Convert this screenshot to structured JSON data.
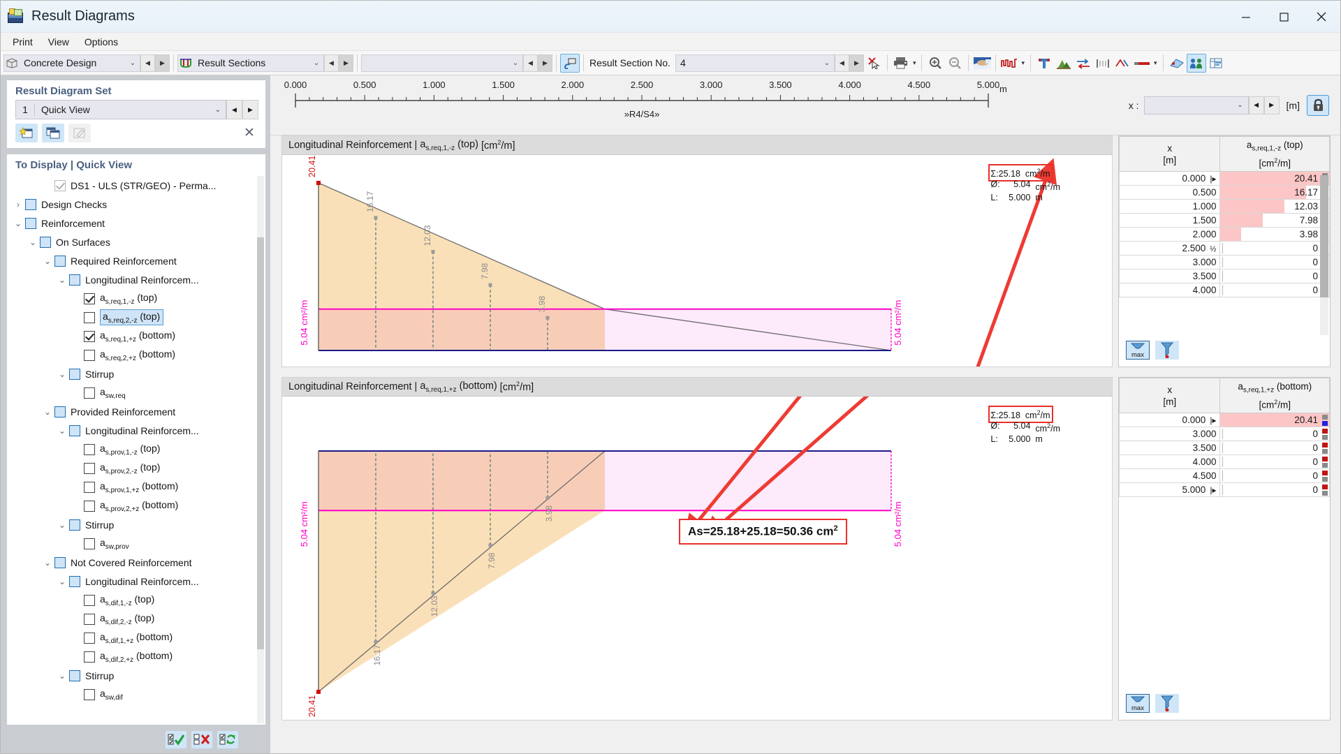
{
  "window": {
    "title": "Result Diagrams",
    "icon": "result-diagrams-icon",
    "minimize": "–",
    "maximize": "□",
    "close": "✕"
  },
  "menu": {
    "items": [
      "Print",
      "View",
      "Options"
    ]
  },
  "toolbar": {
    "module_combo": {
      "value": "Concrete Design",
      "icon": "cube-icon"
    },
    "type_combo": {
      "value": "Result Sections",
      "icon": "result-section-icon"
    },
    "blank_combo": {
      "value": ""
    },
    "snap_button": {
      "name": "pointer-snap-icon"
    },
    "section_label": "Result Section No.",
    "section_value": "4",
    "delete_button": "delete-cursor-icon",
    "print_button": "print-icon",
    "zoom_in_button": "zoom-in-icon",
    "zoom_out_button": "zoom-out-icon",
    "render_button": "render-icon",
    "diagram_button": "diagram-icon",
    "icons": [
      "tee-icon",
      "landscape-icon",
      "exchange-icon",
      "grid-icon",
      "ruler-icon",
      "line-style-icon",
      "surface-icon",
      "people-icon",
      "table-icon"
    ]
  },
  "sidebar": {
    "set_card": {
      "title": "Result Diagram Set",
      "number": "1",
      "value": "Quick View",
      "buttons": [
        "new-set-icon",
        "copy-set-icon",
        "edit-set-icon"
      ],
      "close_label": "✕"
    },
    "tree_card": {
      "title": "To Display | Quick View",
      "items": [
        {
          "label": "DS1 - ULS (STR/GEO) - Perma...",
          "indent": 2,
          "twist": "",
          "check": "gray-checked"
        },
        {
          "label": "Design Checks",
          "indent": 0,
          "twist": "›",
          "check": "tint"
        },
        {
          "label": "Reinforcement",
          "indent": 0,
          "twist": "⌄",
          "check": "tint"
        },
        {
          "label": "On Surfaces",
          "indent": 1,
          "twist": "⌄",
          "check": "tint"
        },
        {
          "label": "Required Reinforcement",
          "indent": 2,
          "twist": "⌄",
          "check": "tint"
        },
        {
          "label": "Longitudinal Reinforcem...",
          "indent": 3,
          "twist": "⌄",
          "check": "tint"
        },
        {
          "label": "as,req,1,-z (top)",
          "indent": 4,
          "twist": "",
          "check": "checked"
        },
        {
          "label": "as,req,2,-z (top)",
          "indent": 4,
          "twist": "",
          "check": "dark",
          "selected": true
        },
        {
          "label": "as,req,1,+z (bottom)",
          "indent": 4,
          "twist": "",
          "check": "checked"
        },
        {
          "label": "as,req,2,+z (bottom)",
          "indent": 4,
          "twist": "",
          "check": "dark"
        },
        {
          "label": "Stirrup",
          "indent": 3,
          "twist": "⌄",
          "check": "tint"
        },
        {
          "label": "asw,req",
          "indent": 4,
          "twist": "",
          "check": "dark"
        },
        {
          "label": "Provided Reinforcement",
          "indent": 2,
          "twist": "⌄",
          "check": "tint"
        },
        {
          "label": "Longitudinal Reinforcem...",
          "indent": 3,
          "twist": "⌄",
          "check": "tint"
        },
        {
          "label": "as,prov,1,-z (top)",
          "indent": 4,
          "twist": "",
          "check": "dark"
        },
        {
          "label": "as,prov,2,-z (top)",
          "indent": 4,
          "twist": "",
          "check": "dark"
        },
        {
          "label": "as,prov,1,+z (bottom)",
          "indent": 4,
          "twist": "",
          "check": "dark"
        },
        {
          "label": "as,prov,2,+z (bottom)",
          "indent": 4,
          "twist": "",
          "check": "dark"
        },
        {
          "label": "Stirrup",
          "indent": 3,
          "twist": "⌄",
          "check": "tint"
        },
        {
          "label": "asw,prov",
          "indent": 4,
          "twist": "",
          "check": "dark"
        },
        {
          "label": "Not Covered Reinforcement",
          "indent": 2,
          "twist": "⌄",
          "check": "tint"
        },
        {
          "label": "Longitudinal Reinforcem...",
          "indent": 3,
          "twist": "⌄",
          "check": "tint"
        },
        {
          "label": "as,dif,1,-z (top)",
          "indent": 4,
          "twist": "",
          "check": "dark"
        },
        {
          "label": "as,dif,2,-z (top)",
          "indent": 4,
          "twist": "",
          "check": "dark"
        },
        {
          "label": "as,dif,1,+z (bottom)",
          "indent": 4,
          "twist": "",
          "check": "dark"
        },
        {
          "label": "as,dif,2,+z (bottom)",
          "indent": 4,
          "twist": "",
          "check": "dark"
        },
        {
          "label": "Stirrup",
          "indent": 3,
          "twist": "⌄",
          "check": "tint"
        },
        {
          "label": "asw,dif",
          "indent": 4,
          "twist": "",
          "check": "dark"
        }
      ]
    },
    "footer_buttons": [
      "check-all-icon",
      "uncheck-all-icon",
      "invert-selection-icon"
    ]
  },
  "ruler": {
    "ticks": [
      "0.000",
      "0.500",
      "1.000",
      "1.500",
      "2.000",
      "2.500",
      "3.000",
      "3.500",
      "4.000",
      "4.500",
      "5.000"
    ],
    "unit": "m",
    "section_label": "»R4/S4»"
  },
  "x_control": {
    "label": "x :",
    "value": "",
    "unit": "[m]",
    "lock_icon": "lock-icon"
  },
  "chart_data": [
    {
      "type": "area",
      "title": "Longitudinal Reinforcement | as,req,1,-z (top) [cm2/m]",
      "title_main": "Longitudinal Reinforcement",
      "title_var": "as,req,1,-z (top)",
      "title_unit": "[cm2/m]",
      "xlabel": "",
      "ylabel": "cm2/m",
      "x": [
        0.0,
        0.5,
        1.0,
        1.5,
        2.0,
        2.5,
        3.0,
        3.5,
        4.0
      ],
      "values": [
        20.41,
        16.17,
        12.03,
        7.98,
        3.98,
        0,
        0,
        0,
        0
      ],
      "labels": [
        "20.41",
        "16.17",
        "12.03",
        "7.98",
        "3.98"
      ],
      "threshold_value": 5.04,
      "threshold_label": "5.04 cm2/m",
      "threshold_color": "#ff00c8",
      "fill_above": "#fae0b8",
      "fill_below": "#f8cdb8",
      "xlim": [
        0,
        5
      ],
      "ylim": [
        0,
        20.41
      ],
      "summary": {
        "sum_key": "Σ:",
        "sum_value": "25.18",
        "sum_unit": "cm2/m",
        "avg_key": "Ø:",
        "avg_value": "5.04",
        "avg_unit": "cm2/m",
        "len_key": "L:",
        "len_value": "5.000",
        "len_unit": "m"
      }
    },
    {
      "type": "area",
      "title": "Longitudinal Reinforcement | as,req,1,+z (bottom) [cm2/m]",
      "title_main": "Longitudinal Reinforcement",
      "title_var": "as,req,1,+z (bottom)",
      "title_unit": "[cm2/m]",
      "xlabel": "",
      "ylabel": "cm2/m",
      "x": [
        0.0,
        0.5,
        1.0,
        1.5,
        2.0,
        3.0,
        3.5,
        4.0,
        4.5,
        5.0
      ],
      "values": [
        20.41,
        16.17,
        12.03,
        7.98,
        3.98,
        0,
        0,
        0,
        0,
        0
      ],
      "labels": [
        "20.41",
        "16.17",
        "12.03",
        "7.98",
        "3.98"
      ],
      "threshold_value": 5.04,
      "threshold_label": "5.04 cm2/m",
      "threshold_color": "#ff00c8",
      "fill_above": "#fae0b8",
      "fill_below": "#f8cdb8",
      "xlim": [
        0,
        5
      ],
      "ylim": [
        0,
        20.41
      ],
      "summary": {
        "sum_key": "Σ:",
        "sum_value": "25.18",
        "sum_unit": "cm2/m",
        "avg_key": "Ø:",
        "avg_value": "5.04",
        "avg_unit": "cm2/m",
        "len_key": "L:",
        "len_value": "5.000",
        "len_unit": "m"
      }
    }
  ],
  "callout": {
    "text": "As=25.18+25.18=50.36 cm2",
    "text_base": "As=25.18+25.18=50.36 cm",
    "sup": "2"
  },
  "tables": [
    {
      "col_x": "x",
      "col_x_unit": "[m]",
      "col_v": "as,req,1,-z (top)",
      "col_v_unit": "[cm2/m]",
      "max_button": "max",
      "filter_button": "filter-icon",
      "rows": [
        {
          "x": "0.000",
          "flag": "start",
          "v": "20.41",
          "bar": 100,
          "marks": [
            "#8a8a8a",
            "#2222dd"
          ]
        },
        {
          "x": "0.500",
          "flag": "",
          "v": "16.17",
          "bar": 79,
          "marks": []
        },
        {
          "x": "1.000",
          "flag": "",
          "v": "12.03",
          "bar": 59,
          "marks": []
        },
        {
          "x": "1.500",
          "flag": "",
          "v": "7.98",
          "bar": 39,
          "marks": []
        },
        {
          "x": "2.000",
          "flag": "",
          "v": "3.98",
          "bar": 19,
          "marks": []
        },
        {
          "x": "2.500",
          "flag": "half",
          "v": "0",
          "bar": 0,
          "marks": []
        },
        {
          "x": "3.000",
          "flag": "",
          "v": "0",
          "bar": 0,
          "marks": [
            "#c01414",
            "#8a8a8a"
          ]
        },
        {
          "x": "3.500",
          "flag": "",
          "v": "0",
          "bar": 0,
          "marks": [
            "#c01414",
            "#8a8a8a"
          ]
        },
        {
          "x": "4.000",
          "flag": "",
          "v": "0",
          "bar": 0,
          "marks": [
            "#c01414",
            "#8a8a8a"
          ]
        }
      ]
    },
    {
      "col_x": "x",
      "col_x_unit": "[m]",
      "col_v": "as,req,1,+z (bottom)",
      "col_v_unit": "[cm2/m]",
      "max_button": "max",
      "filter_button": "filter-icon",
      "rows": [
        {
          "x": "0.000",
          "flag": "start",
          "v": "20.41",
          "bar": 100,
          "marks": [
            "#8a8a8a",
            "#2222dd"
          ]
        },
        {
          "x": "3.000",
          "flag": "",
          "v": "0",
          "bar": 0,
          "marks": [
            "#c01414",
            "#8a8a8a"
          ]
        },
        {
          "x": "3.500",
          "flag": "",
          "v": "0",
          "bar": 0,
          "marks": [
            "#c01414",
            "#8a8a8a"
          ]
        },
        {
          "x": "4.000",
          "flag": "",
          "v": "0",
          "bar": 0,
          "marks": [
            "#c01414",
            "#8a8a8a"
          ]
        },
        {
          "x": "4.500",
          "flag": "",
          "v": "0",
          "bar": 0,
          "marks": [
            "#c01414",
            "#8a8a8a"
          ]
        },
        {
          "x": "5.000",
          "flag": "end",
          "v": "0",
          "bar": 0,
          "marks": [
            "#c01414",
            "#8a8a8a"
          ]
        }
      ]
    }
  ]
}
